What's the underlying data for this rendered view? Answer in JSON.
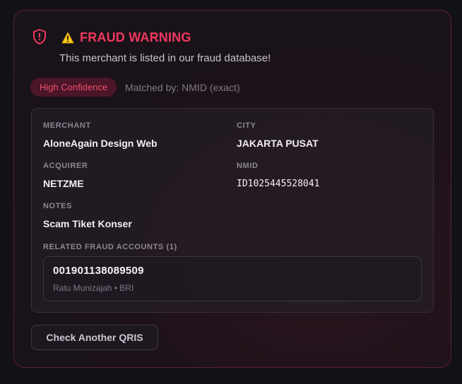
{
  "alert": {
    "title": "FRAUD WARNING",
    "subtitle": "This merchant is listed in our fraud database!",
    "confidence_badge": "High Confidence",
    "matched_by": "Matched by: NMID (exact)"
  },
  "details": {
    "merchant_label": "MERCHANT",
    "merchant_value": "AloneAgain Design Web",
    "city_label": "CITY",
    "city_value": "JAKARTA PUSAT",
    "acquirer_label": "ACQUIRER",
    "acquirer_value": "NETZME",
    "nmid_label": "NMID",
    "nmid_value": "ID1025445528041",
    "notes_label": "NOTES",
    "notes_value": "Scam Tiket Konser",
    "related_label": "RELATED FRAUD ACCOUNTS (1)",
    "related_accounts": [
      {
        "number": "001901138089509",
        "owner_bank": "Ratu Munizajah • BRI"
      }
    ]
  },
  "actions": {
    "check_another": "Check Another QRIS"
  },
  "icons": {
    "shield": "shield-alert-icon",
    "warning": "warning-triangle-icon"
  },
  "colors": {
    "danger": "#f0385f",
    "badge_bg": "#4a1628",
    "card_border": "#5c1f36"
  }
}
